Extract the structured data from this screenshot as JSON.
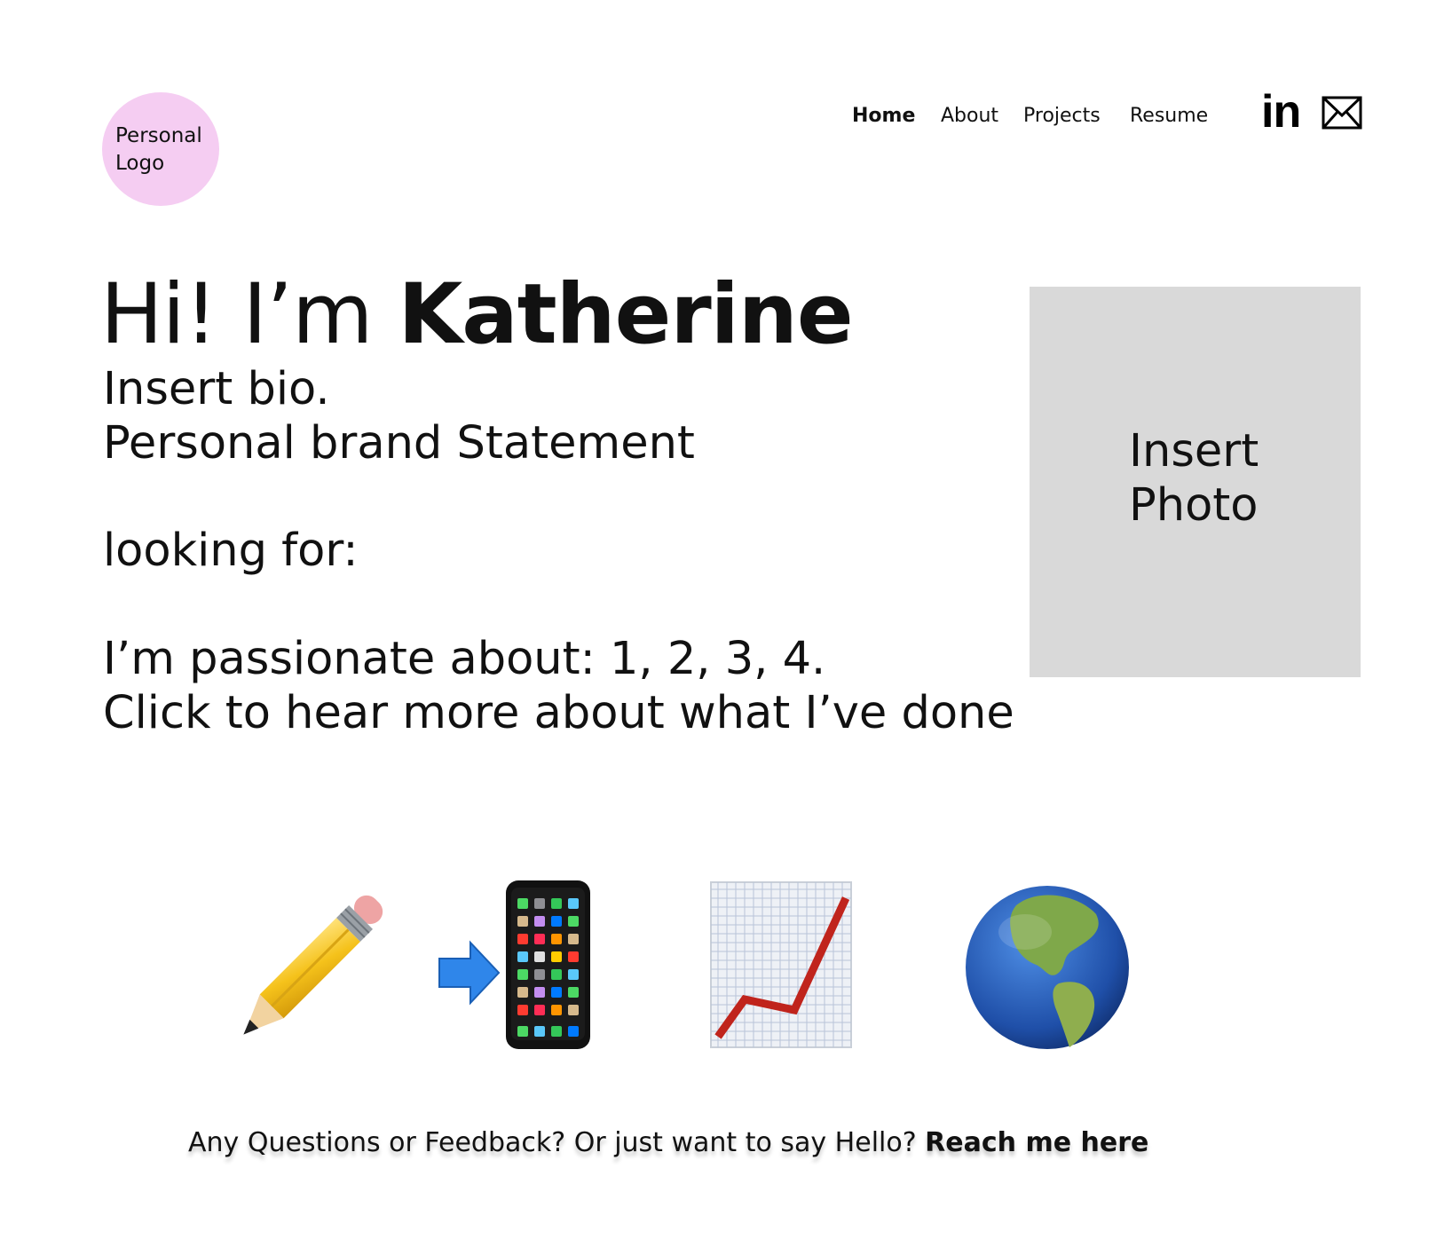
{
  "logo": {
    "line1": "Personal",
    "line2": "Logo"
  },
  "nav": {
    "items": [
      {
        "label": "Home",
        "active": true
      },
      {
        "label": "About"
      },
      {
        "label": "Projects"
      },
      {
        "label": "Resume"
      }
    ],
    "social": {
      "linkedin_text": "in",
      "mail_icon": "mail-icon"
    }
  },
  "hero": {
    "greeting": "Hi! I’m",
    "name": "Katherine",
    "bio": "Insert bio.",
    "brand": "Personal brand Statement",
    "looking": "looking for:",
    "passionate": "I’m passionate about: 1, 2, 3, 4.",
    "cta": "Click to hear more about what I’ve done"
  },
  "photo": {
    "line1": "Insert",
    "line2": "Photo"
  },
  "icons": [
    "pencil-icon",
    "phone-with-arrow-icon",
    "chart-increasing-icon",
    "globe-americas-icon"
  ],
  "footer": {
    "text": "Any Questions or Feedback? Or just want to say Hello? ",
    "link": "Reach me here"
  },
  "colors": {
    "logo_bg": "#f5cdf2",
    "photo_bg": "#d9d9d9",
    "text": "#111111"
  }
}
